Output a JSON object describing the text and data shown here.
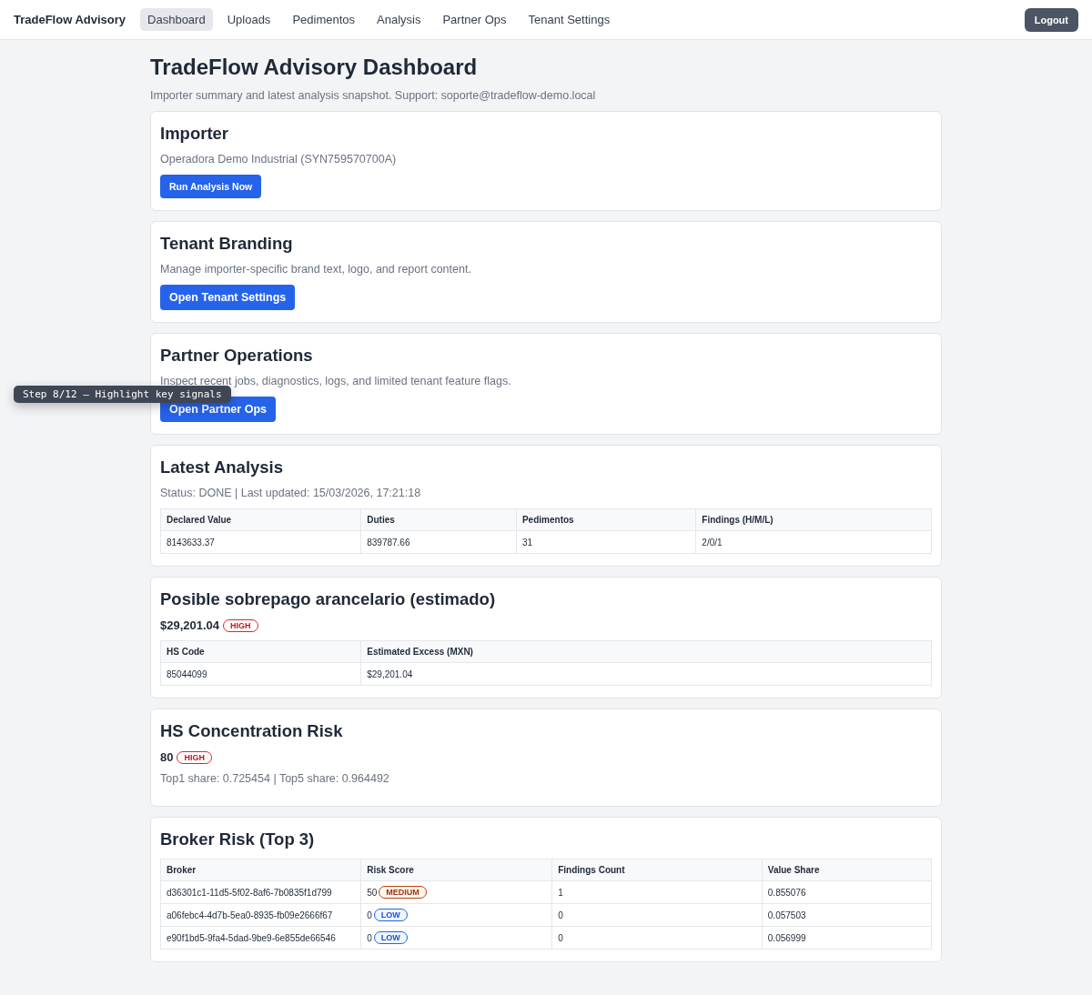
{
  "nav": {
    "brand": "TradeFlow Advisory",
    "links": [
      {
        "label": "Dashboard",
        "selected": true
      },
      {
        "label": "Uploads",
        "selected": false
      },
      {
        "label": "Pedimentos",
        "selected": false
      },
      {
        "label": "Analysis",
        "selected": false
      },
      {
        "label": "Partner Ops",
        "selected": false
      },
      {
        "label": "Tenant Settings",
        "selected": false
      }
    ],
    "logout": "Logout"
  },
  "page": {
    "title": "TradeFlow Advisory Dashboard",
    "subtitle": "Importer summary and latest analysis snapshot. Support: soporte@tradeflow-demo.local"
  },
  "cards": [
    {
      "kind": "action",
      "title": "Importer",
      "text": "Operadora Demo Industrial (SYN759570700A)",
      "button": {
        "label": "Run Analysis Now",
        "kind": "compact"
      }
    },
    {
      "kind": "action",
      "title": "Tenant Branding",
      "text": "Manage importer-specific brand text, logo, and report content.",
      "button": {
        "label": "Open Tenant Settings",
        "kind": "regular"
      }
    },
    {
      "kind": "action",
      "title": "Partner Operations",
      "text": "Inspect recent jobs, diagnostics, logs, and limited tenant feature flags.",
      "button": {
        "label": "Open Partner Ops",
        "kind": "regular"
      },
      "tooltip": "Step 8/12 — Highlight key signals"
    },
    {
      "kind": "table",
      "title": "Latest Analysis",
      "text": "Status: DONE | Last updated: 15/03/2026, 17:21:18",
      "columns": [
        "Declared Value",
        "Duties",
        "Pedimentos",
        "Findings (H/M/L)"
      ],
      "rows": [
        [
          {
            "text": "8143633.37"
          },
          {
            "text": "839787.66"
          },
          {
            "text": "31"
          },
          {
            "text": "2/0/1"
          }
        ]
      ]
    },
    {
      "kind": "table",
      "title": "Posible sobrepago arancelario (estimado)",
      "figure": {
        "text": "$29,201.04",
        "badge": {
          "text": "HIGH",
          "kind": "high"
        }
      },
      "columns": [
        "HS Code",
        "Estimated Excess (MXN)"
      ],
      "rows": [
        [
          {
            "text": "85044099"
          },
          {
            "text": "$29,201.04"
          }
        ]
      ]
    },
    {
      "kind": "metric",
      "title": "HS Concentration Risk",
      "figure": {
        "text": "80",
        "badge": {
          "text": "HIGH",
          "kind": "high"
        }
      },
      "text": "Top1 share: 0.725454 | Top5 share: 0.964492"
    },
    {
      "kind": "table",
      "title": "Broker Risk (Top 3)",
      "columns": [
        "Broker",
        "Risk Score",
        "Findings Count",
        "Value Share"
      ],
      "rows": [
        [
          {
            "text": "d36301c1-11d5-5f02-8af6-7b0835f1d799"
          },
          {
            "text": "50",
            "badge": {
              "text": "MEDIUM",
              "kind": "medium"
            }
          },
          {
            "text": "1"
          },
          {
            "text": "0.855076"
          }
        ],
        [
          {
            "text": "a06febc4-4d7b-5ea0-8935-fb09e2666f67"
          },
          {
            "text": "0",
            "badge": {
              "text": "LOW",
              "kind": "low"
            }
          },
          {
            "text": "0"
          },
          {
            "text": "0.057503"
          }
        ],
        [
          {
            "text": "e90f1bd5-9fa4-5dad-9be9-6e855de66546"
          },
          {
            "text": "0",
            "badge": {
              "text": "LOW",
              "kind": "low"
            }
          },
          {
            "text": "0"
          },
          {
            "text": "0.056999"
          }
        ]
      ]
    }
  ]
}
